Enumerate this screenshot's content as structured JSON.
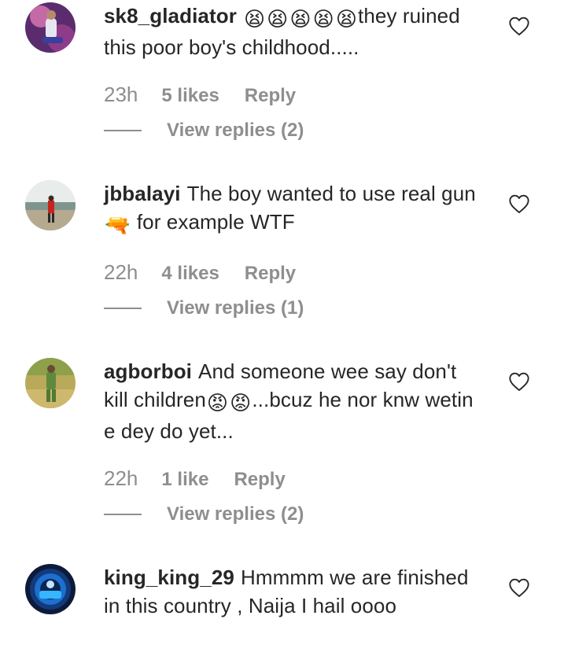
{
  "comments": [
    {
      "username": "sk8_gladiator",
      "emoji": [
        "😫",
        "😫",
        "😫",
        "😫",
        "😫"
      ],
      "text": "they ruined this poor boy's childhood.....",
      "time": "23h",
      "likes": "5 likes",
      "reply": "Reply",
      "view_replies": "View replies (2)"
    },
    {
      "username": "jbbalayi",
      "text_before": "The boy wanted to use real gun",
      "emoji": "🔫",
      "text_after": "for example WTF",
      "time": "22h",
      "likes": "4 likes",
      "reply": "Reply",
      "view_replies": "View replies (1)"
    },
    {
      "username": "agborboi",
      "text_before": "And someone wee say don't kill children",
      "emoji": [
        "😡",
        "😡"
      ],
      "text_after": "...bcuz he nor knw wetin e dey do yet...",
      "time": "22h",
      "likes": "1 like",
      "reply": "Reply",
      "view_replies": "View replies (2)"
    },
    {
      "username": "king_king_29",
      "text": "Hmmmm we are finished in this country , Naija I hail oooo"
    }
  ],
  "icons": {
    "like": "heart-outline-icon"
  },
  "colors": {
    "text": "#262626",
    "secondary": "#8e8e8e"
  }
}
